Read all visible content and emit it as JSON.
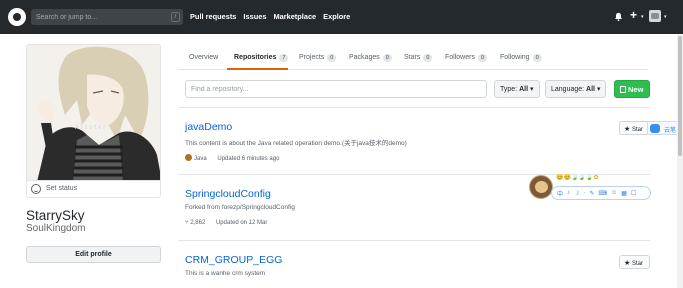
{
  "header": {
    "search_placeholder": "Search or jump to...",
    "search_shortcut": "/",
    "nav": [
      "Pull requests",
      "Issues",
      "Marketplace",
      "Explore"
    ],
    "plus_glyph": "+",
    "caret_glyph": "▾"
  },
  "profile": {
    "avatar_watermark": "Alister",
    "set_status": "Set status",
    "name": "StarrySky",
    "login": "SoulKingdom",
    "edit_button": "Edit profile"
  },
  "tabs": [
    {
      "label": "Overview",
      "count": null,
      "selected": false
    },
    {
      "label": "Repositories",
      "count": "7",
      "selected": true
    },
    {
      "label": "Projects",
      "count": "0",
      "selected": false
    },
    {
      "label": "Packages",
      "count": "0",
      "selected": false
    },
    {
      "label": "Stars",
      "count": "0",
      "selected": false
    },
    {
      "label": "Followers",
      "count": "0",
      "selected": false
    },
    {
      "label": "Following",
      "count": "0",
      "selected": false
    }
  ],
  "filter": {
    "placeholder": "Find a repository...",
    "type_label": "Type:",
    "type_value": "All",
    "language_label": "Language:",
    "language_value": "All",
    "new_button": "New"
  },
  "repos": [
    {
      "name": "javaDemo",
      "description": "This content is about the Java related operation demo.(关于java技术的demo)",
      "language": "Java",
      "updated": "Updated 6 minutes ago",
      "star_label": "Star"
    },
    {
      "name": "SpringcloudConfig",
      "forked_from": "Forked from forezp/SpringcloudConfig",
      "forks": "2,862",
      "updated": "Updated on 12 Mar"
    },
    {
      "name": "CRM_GROUP_EGG",
      "description": "This is a wanhe crm system",
      "star_label": "Star"
    }
  ],
  "overlay": {
    "side_tab_label": "云笔",
    "ime_status": "中",
    "ime_glyphs": [
      "中",
      "♪",
      "☽",
      "·",
      "✎",
      "⌨",
      "☺",
      "▦",
      "☐"
    ]
  },
  "colors": {
    "header_bg": "#24292e",
    "link": "#0366d6",
    "accent_tab": "#e36209",
    "new_button": "#2cbe4e",
    "java": "#b07219"
  }
}
